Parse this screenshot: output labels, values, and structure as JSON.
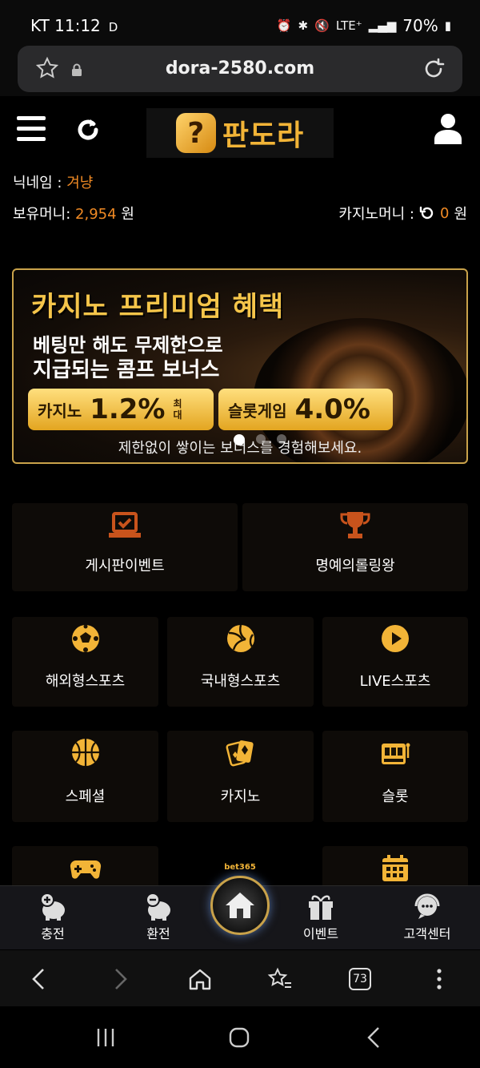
{
  "status_bar": {
    "carrier_time": "KT 11:12",
    "indicator": "D",
    "network": "LTE⁺",
    "battery": "70%"
  },
  "browser": {
    "url": "dora-2580.com",
    "tab_count": "73"
  },
  "header": {
    "logo_text": "판도라",
    "logo_badge": "?"
  },
  "user": {
    "nickname_label": "닉네임 :",
    "nickname": "겨냥",
    "money_label": "보유머니:",
    "money_value": "2,954",
    "money_unit": "원",
    "casino_label": "카지노머니 :",
    "casino_value": "0",
    "casino_unit": "원"
  },
  "banner": {
    "title": "카지노 프리미엄 혜택",
    "sub1_prefix": "베팅만 해도 ",
    "sub1_bold": "무제한으로",
    "sub2": "지급되는 콤프 보너스",
    "pill1_label": "카지노",
    "pill1_value": "1.2%",
    "pill1_max": "최대",
    "pill2_label": "슬롯게임",
    "pill2_value": "4.0%",
    "caption": "제한없이 쌓이는 보너스를 경험해보세요."
  },
  "menu": {
    "board_event": "게시판이벤트",
    "rolling_king": "명예의롤링왕",
    "overseas_sports": "해외형스포츠",
    "domestic_sports": "국내형스포츠",
    "live_sports": "LIVE스포츠",
    "special": "스페셜",
    "casino": "카지노",
    "slot": "슬롯"
  },
  "bottom_nav": {
    "charge": "충전",
    "exchange": "환전",
    "bet365": "bet365",
    "event": "이벤트",
    "support": "고객센터"
  },
  "colors": {
    "accent": "#f08a24",
    "gold": "#f2b437"
  }
}
